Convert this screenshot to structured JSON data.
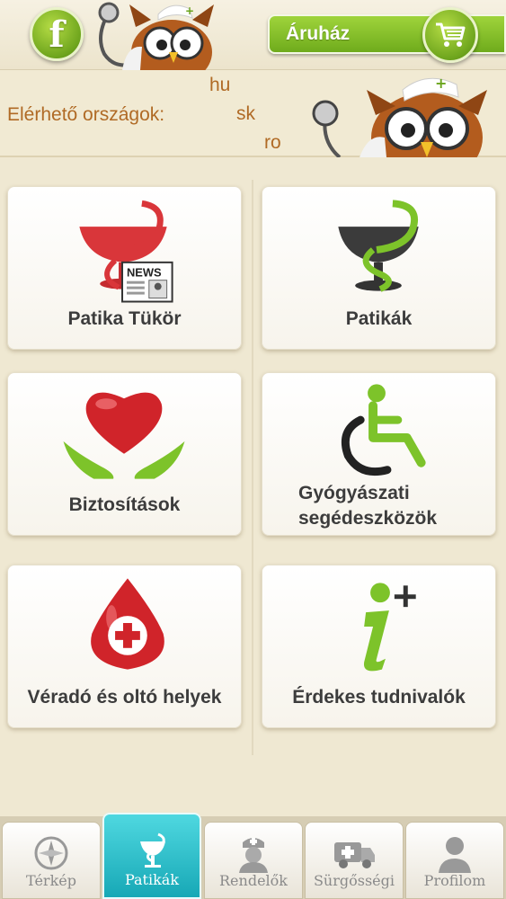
{
  "header": {
    "facebook_icon": "facebook-icon",
    "store_label": "Áruház",
    "cart_icon": "shopping-cart-icon"
  },
  "countries": {
    "label": "Elérhető országok:",
    "codes": [
      "hu",
      "sk",
      "ro"
    ]
  },
  "tiles": [
    {
      "label": "Patika Tükör",
      "icon": "news-pharmacy-icon"
    },
    {
      "label": "Patikák",
      "icon": "pharmacy-icon"
    },
    {
      "label": "Biztosítások",
      "icon": "heart-hands-icon"
    },
    {
      "label_line1": "Gyógyászati",
      "label_line2": "segédeszközök",
      "icon": "wheelchair-icon"
    },
    {
      "label": "Véradó és oltó helyek",
      "icon": "blood-drop-icon"
    },
    {
      "label": "Érdekes tudnivalók",
      "icon": "info-plus-icon"
    }
  ],
  "tabs": [
    {
      "label": "Térkép",
      "icon": "compass-icon"
    },
    {
      "label": "Patikák",
      "icon": "pharmacy-icon",
      "active": true
    },
    {
      "label": "Rendelők",
      "icon": "nurse-icon"
    },
    {
      "label": "Sürgősségi",
      "icon": "ambulance-icon"
    },
    {
      "label": "Profilom",
      "icon": "person-icon"
    }
  ],
  "colors": {
    "accent_green": "#7bb325",
    "active_tab": "#22b3c0",
    "country_text": "#b06a25",
    "background": "#efe8d2"
  }
}
